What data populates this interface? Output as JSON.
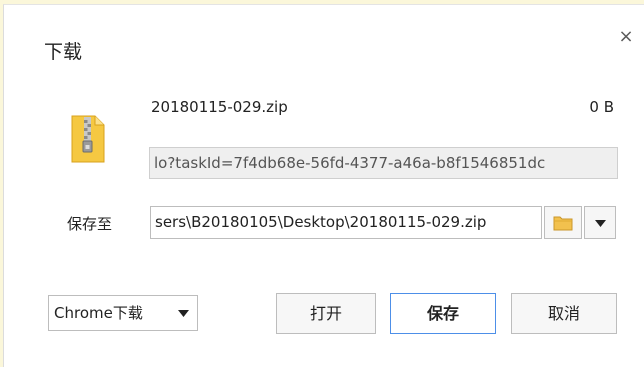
{
  "dialog": {
    "title": "下载",
    "close_symbol": "×",
    "close_icon": "close-icon"
  },
  "file": {
    "icon": "zip-file-icon",
    "name": "20180115-029.zip",
    "size": "0 B",
    "url": "lo?taskId=7f4db68e-56fd-4377-a46a-b8f1546851dc"
  },
  "save_to": {
    "label": "保存至",
    "path": "sers\\B20180105\\Desktop\\20180115-029.zip",
    "folder_icon": "folder-icon",
    "dropdown_icon": "triangle-down-icon"
  },
  "footer": {
    "mode_select_value": "Chrome下载",
    "open_label": "打开",
    "save_label": "保存",
    "cancel_label": "取消"
  },
  "colors": {
    "zip_icon": "#f5c842",
    "folder_icon": "#f2c14e",
    "primary_border": "#4d8fe8"
  }
}
